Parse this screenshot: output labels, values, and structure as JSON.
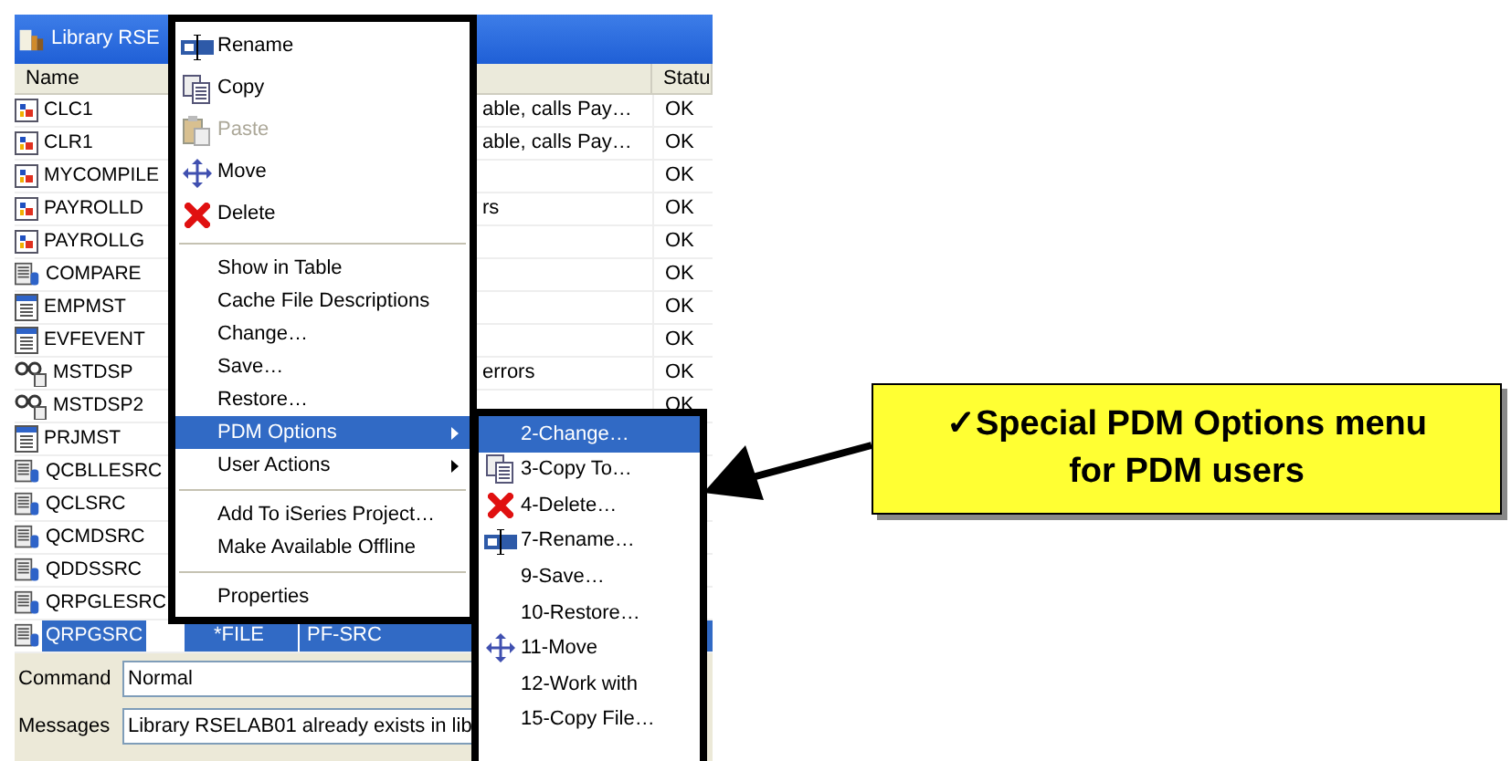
{
  "window": {
    "title": "Library RSE"
  },
  "table": {
    "columns": [
      {
        "label": "Name"
      },
      {
        "label": "Statu"
      }
    ],
    "rows": [
      {
        "kind": "program",
        "name": "CLC1",
        "text": "able, calls Pay…",
        "status": "OK",
        "selected": false
      },
      {
        "kind": "program",
        "name": "CLR1",
        "text": "able, calls Pay…",
        "status": "OK",
        "selected": false
      },
      {
        "kind": "program",
        "name": "MYCOMPILE",
        "status": "OK",
        "selected": false
      },
      {
        "kind": "program",
        "name": "PAYROLLD",
        "text": "rs",
        "status": "OK",
        "selected": false
      },
      {
        "kind": "program",
        "name": "PAYROLLG",
        "status": "OK",
        "selected": false
      },
      {
        "kind": "source",
        "name": "COMPARE",
        "status": "OK",
        "selected": false
      },
      {
        "kind": "data",
        "name": "EMPMST",
        "status": "OK",
        "selected": false
      },
      {
        "kind": "data",
        "name": "EVFEVENT",
        "status": "OK",
        "selected": false
      },
      {
        "kind": "display",
        "name": "MSTDSP",
        "text": "errors",
        "status": "OK",
        "selected": false
      },
      {
        "kind": "display",
        "name": "MSTDSP2",
        "status": "OK",
        "selected": false
      },
      {
        "kind": "data",
        "name": "PRJMST",
        "selected": false
      },
      {
        "kind": "source",
        "name": "QCBLLESRC",
        "selected": false
      },
      {
        "kind": "source",
        "name": "QCLSRC",
        "selected": false
      },
      {
        "kind": "source",
        "name": "QCMDSRC",
        "selected": false
      },
      {
        "kind": "source",
        "name": "QDDSSRC",
        "selected": false
      },
      {
        "kind": "source",
        "name": "QRPGLESRC",
        "selected": false
      },
      {
        "kind": "source",
        "name": "QRPGSRC",
        "type": "*FILE",
        "attribute": "PF-SRC",
        "selected": true
      }
    ]
  },
  "fields": [
    {
      "label": "Command",
      "value": "Normal"
    },
    {
      "label": "Messages",
      "value": "Library RSELAB01 already exists in lib"
    }
  ],
  "context_menu": [
    {
      "kind": "rename",
      "label": "Rename",
      "disabled": false,
      "selected": false,
      "submenu": false
    },
    {
      "kind": "copy",
      "label": "Copy",
      "disabled": false,
      "selected": false,
      "submenu": false
    },
    {
      "kind": "paste",
      "label": "Paste",
      "disabled": true,
      "selected": false,
      "submenu": false
    },
    {
      "kind": "move",
      "label": "Move",
      "disabled": false,
      "selected": false,
      "submenu": false
    },
    {
      "kind": "delete",
      "label": "Delete",
      "disabled": false,
      "selected": false,
      "submenu": false
    },
    {
      "kind": "separator"
    },
    {
      "kind": "plain",
      "label": "Show in Table",
      "disabled": false,
      "selected": false,
      "submenu": false
    },
    {
      "kind": "plain",
      "label": "Cache File Descriptions",
      "disabled": false,
      "selected": false,
      "submenu": false
    },
    {
      "kind": "plain",
      "label": "Change…",
      "disabled": false,
      "selected": false,
      "submenu": false
    },
    {
      "kind": "plain",
      "label": "Save…",
      "disabled": false,
      "selected": false,
      "submenu": false
    },
    {
      "kind": "plain",
      "label": "Restore…",
      "disabled": false,
      "selected": false,
      "submenu": false
    },
    {
      "kind": "plain",
      "label": "PDM Options",
      "disabled": false,
      "selected": true,
      "submenu": true
    },
    {
      "kind": "plain",
      "label": "User Actions",
      "disabled": false,
      "selected": false,
      "submenu": true
    },
    {
      "kind": "separator"
    },
    {
      "kind": "plain",
      "label": "Add To iSeries Project…",
      "disabled": false,
      "selected": false,
      "submenu": false
    },
    {
      "kind": "plain",
      "label": "Make Available Offline",
      "disabled": false,
      "selected": false,
      "submenu": false
    },
    {
      "kind": "separator"
    },
    {
      "kind": "plain",
      "label": "Properties",
      "disabled": false,
      "selected": false,
      "submenu": false
    }
  ],
  "pdm_submenu": [
    {
      "kind": "plain",
      "label": "2-Change…",
      "selected": true
    },
    {
      "kind": "copy",
      "label": "3-Copy To…",
      "selected": false
    },
    {
      "kind": "delete",
      "label": "4-Delete…",
      "selected": false
    },
    {
      "kind": "rename",
      "label": "7-Rename…",
      "selected": false
    },
    {
      "kind": "plain",
      "label": "9-Save…",
      "selected": false
    },
    {
      "kind": "plain",
      "label": "10-Restore…",
      "selected": false
    },
    {
      "kind": "move",
      "label": "11-Move",
      "selected": false
    },
    {
      "kind": "plain",
      "label": "12-Work with",
      "selected": false
    },
    {
      "kind": "plain",
      "label": "15-Copy File…",
      "selected": false
    }
  ],
  "callout": {
    "lines": [
      "✓Special PDM Options menu",
      "for PDM users"
    ]
  }
}
